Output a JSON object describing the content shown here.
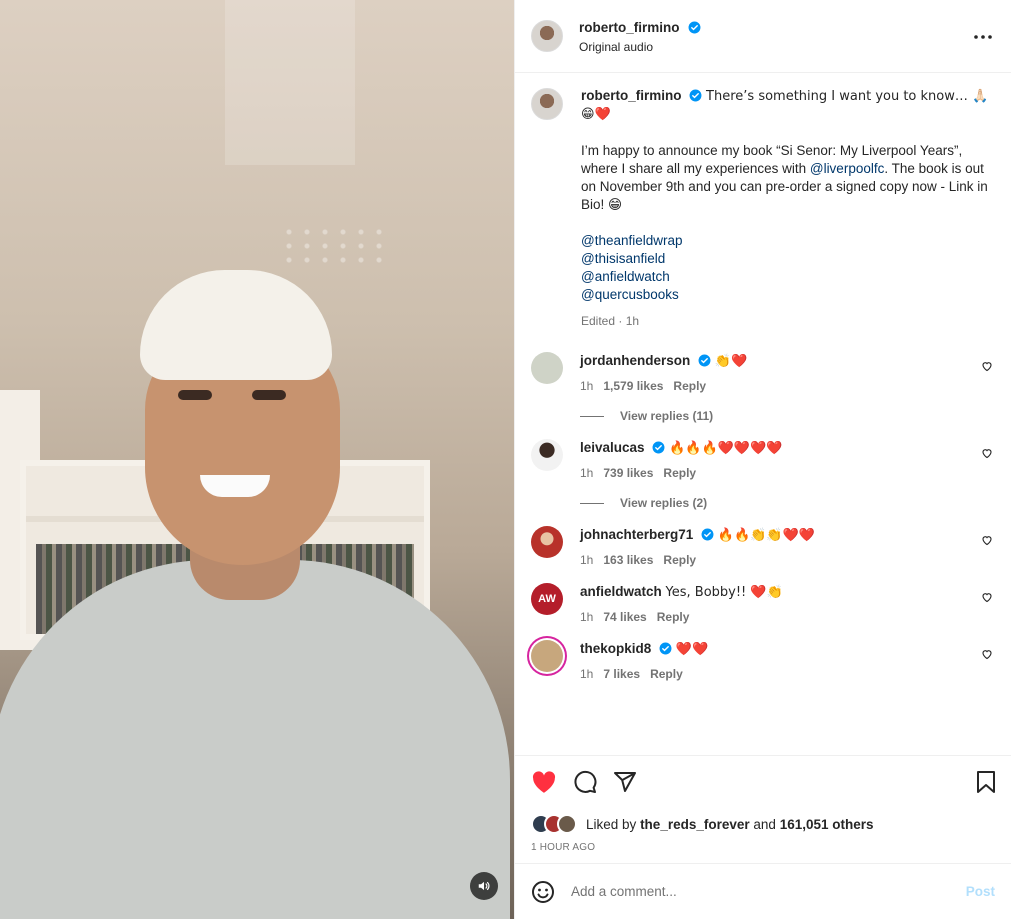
{
  "video": {
    "mute_icon": "speaker-icon"
  },
  "header": {
    "username": "roberto_firmino",
    "subtitle": "Original audio",
    "more_icon": "more-dots-icon"
  },
  "caption": {
    "username": "roberto_firmino",
    "line1": "There’s something I want you to know… 🙏🏻",
    "line2": "😁❤️",
    "paragraph_a": "I’m happy to announce my book “Si Senor: My Liverpool Years”, where I share all my experiences with ",
    "paragraph_mention": "@liverpoolfc",
    "paragraph_b": ". The book is out on November 9th and you can pre-order a signed copy now - Link in Bio! 😁",
    "mentions": [
      "@theanfieldwrap",
      "@thisisanfield",
      "@anfieldwatch",
      "@quercusbooks"
    ],
    "meta": "Edited · 1h"
  },
  "comments": [
    {
      "username": "jordanhenderson",
      "verified": true,
      "text": "👏❤️",
      "time": "1h",
      "likes": "1,579 likes",
      "reply": "Reply",
      "view_replies": "View replies (11)",
      "avatar_color": "#cfd3c7"
    },
    {
      "username": "leivalucas",
      "verified": true,
      "text": "🔥🔥🔥❤️❤️❤️❤️",
      "time": "1h",
      "likes": "739 likes",
      "reply": "Reply",
      "view_replies": "View replies (2)",
      "avatar_color": "#e9e9e9"
    },
    {
      "username": "johnachterberg71",
      "verified": true,
      "text": "🔥🔥👏👏❤️❤️",
      "time": "1h",
      "likes": "163 likes",
      "reply": "Reply",
      "avatar_color": "#b8322a"
    },
    {
      "username": "anfieldwatch",
      "verified": false,
      "text": "Yes, Bobby!! ❤️👏",
      "time": "1h",
      "likes": "74 likes",
      "reply": "Reply",
      "avatar_color": "#b41e2a",
      "avatar_text": "AW"
    },
    {
      "username": "thekopkid8",
      "verified": true,
      "text": "❤️❤️",
      "time": "1h",
      "likes": "7 likes",
      "reply": "Reply",
      "avatar_color": "#c7a77d"
    }
  ],
  "actions": {
    "like_icon": "heart-filled-icon",
    "comment_icon": "comment-bubble-icon",
    "share_icon": "paper-plane-icon",
    "save_icon": "bookmark-icon"
  },
  "likes": {
    "prefix": "Liked by",
    "user": "the_reds_forever",
    "middle": "and",
    "others": "161,051 others"
  },
  "time_ago": "1 HOUR AGO",
  "comment_input": {
    "placeholder": "Add a comment...",
    "post_label": "Post",
    "emoji_icon": "smiley-icon"
  },
  "colors": {
    "like_red": "#ff3040",
    "verified_blue": "#0095f6",
    "link_blue": "#00376b",
    "post_disabled": "#b2dffc"
  }
}
